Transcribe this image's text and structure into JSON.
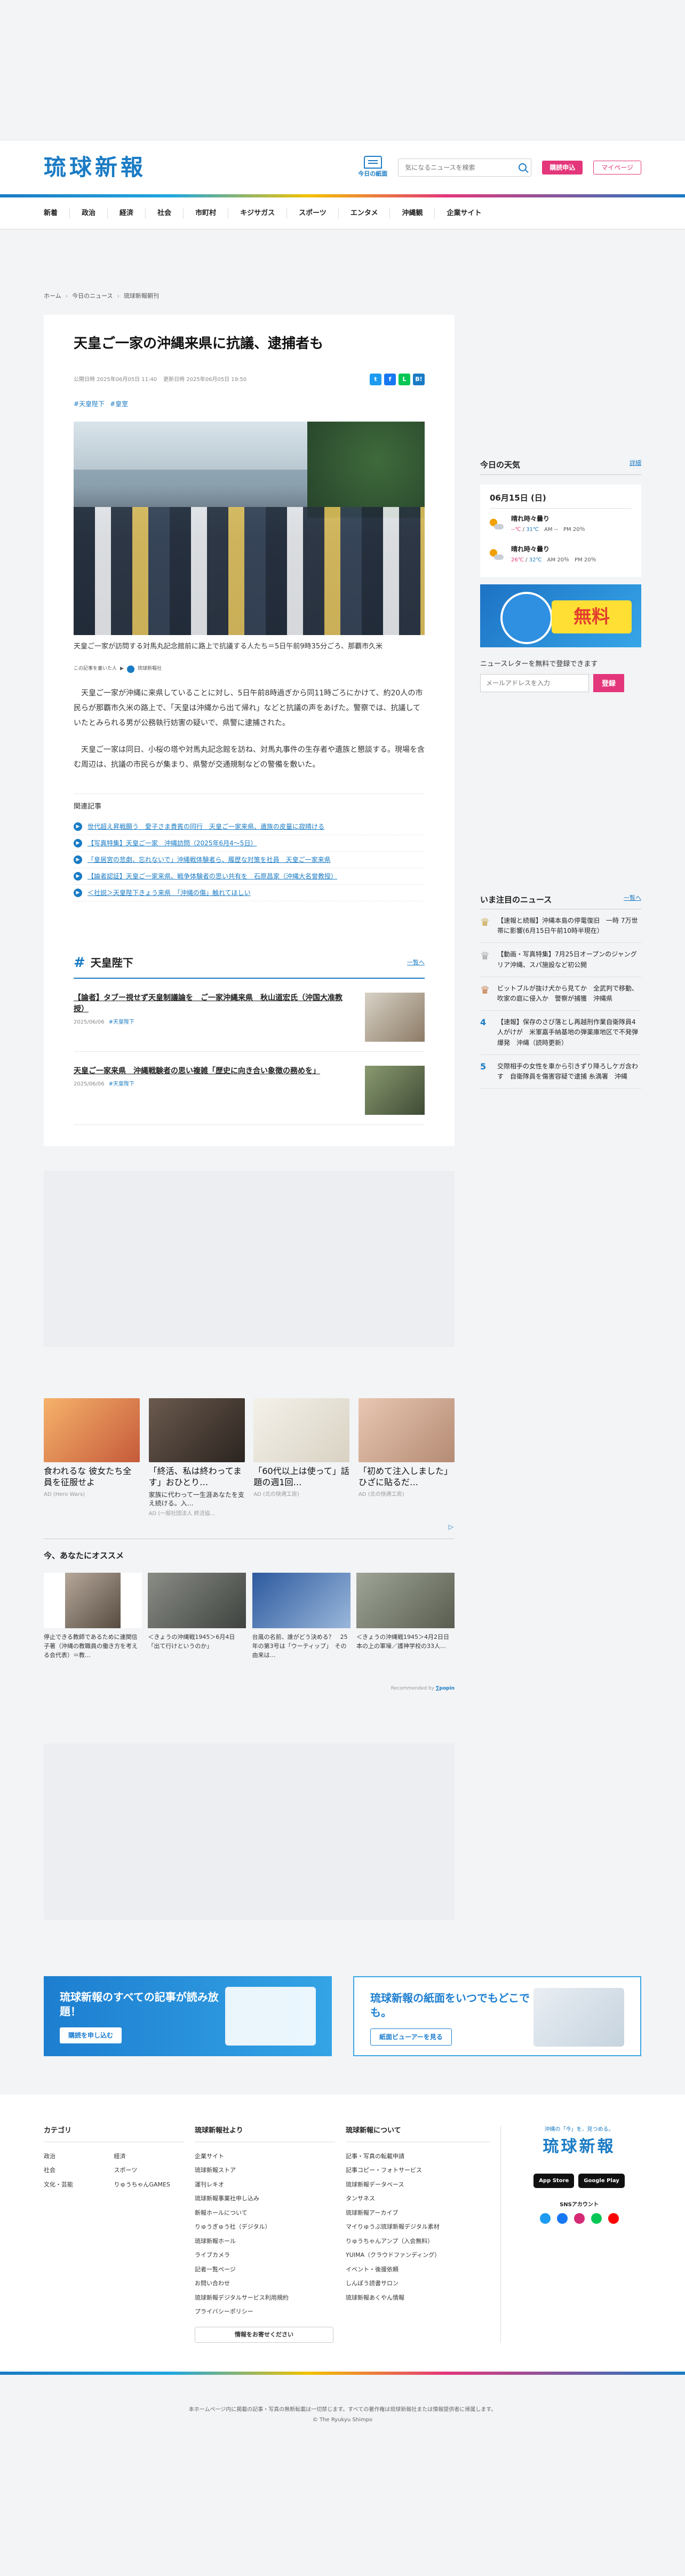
{
  "header": {
    "logo": "琉球新報",
    "today_paper": "今日の紙面",
    "search_placeholder": "気になるニュースを検索",
    "subscribe": "購読申込",
    "mypage": "マイページ"
  },
  "nav": [
    "政治",
    "経済",
    "社会",
    "市町村",
    "キジサガス",
    "スポーツ",
    "エンタメ",
    "沖縄観",
    "企業サイト"
  ],
  "nav_first": "新着",
  "breadcrumb": [
    "ホーム",
    "今日のニュース",
    "琉球新報朝刊"
  ],
  "article": {
    "title": "天皇ご一家の沖縄来県に抗議、逮捕者も",
    "published": "公開日時 2025年06月05日 11:40",
    "updated": "更新日時 2025年06月05日 19:50",
    "tags": [
      "#天皇陛下",
      "#皇室"
    ],
    "caption": "天皇ご一家が訪問する対馬丸記念館前に路上で抗議する人たち＝5日午前9時35分ごろ、那覇市久米",
    "reporter": "この記事を書いた人",
    "reporter_name": "琉球新報社",
    "paragraphs": [
      "天皇ご一家が沖縄に来県していることに対し、5日午前8時過ぎから同11時ごろにかけて、約20人の市民らが那覇市久米の路上で、「天皇は沖縄から出て帰れ」などと抗議の声をあげた。警察では、抗議していたとみられる男が公務執行妨害の疑いで、県警に逮捕された。",
      "天皇ご一家は同日、小桜の塔や対馬丸記念館を訪ね、対馬丸事件の生存者や遺族と懇談する。現場を含む周辺は、抗議の市民らが集まり、県警が交通規制などの警備を敷いた。"
    ],
    "related_title": "関連記事",
    "related": [
      "世代超え昇戦願う　愛子さま貴賓の同行　天皇ご一家来県、遺族の皮量に寂晴ける",
      "【写真特集】天皇ご一家　沖縄訪問（2025年6月4〜5日）",
      "「皇居宮の悲劇、忘れないで」沖縄戦体験者ら、履歴な対策を社員　天皇ご一家来県",
      "【論者認証】天皇ご一家来県、戦争体験者の思い共有を　石原昌家（沖縄大名誉教授）",
      "＜社説＞天皇陛下きょう来県　「沖縄の傷」触れてほしい"
    ]
  },
  "tag_section": {
    "title": "天皇陛下",
    "more": "一覧へ",
    "items": [
      {
        "title": "【論者】タブー視せず天皇制議論を　ご一家沖縄来県　秋山道宏氏（沖国大准教授）",
        "date": "2025/06/06",
        "tag": "#天皇陛下"
      },
      {
        "title": "天皇ご一家来県　沖縄戦験者の思い複雑「歴史に向き合い象徴の務めを」",
        "date": "2025/06/06",
        "tag": "#天皇陛下"
      }
    ]
  },
  "ads": [
    {
      "headline": "食われるな 彼女たち全員を征服せよ",
      "sub": "",
      "source": "AD (Hero Wars)"
    },
    {
      "headline": "「終活、私は終わってます」おひとり…",
      "sub": "家族に代わって一生涯あなたを支え続ける。入…",
      "source": "AD (一般社団法人 終活協…"
    },
    {
      "headline": "「60代以上は使って」話題の週1回…",
      "sub": "",
      "source": "AD (北の快適工房)"
    },
    {
      "headline": "「初めて注入しました」ひざに貼るだ…",
      "sub": "",
      "source": "AD (北の快適工房)"
    }
  ],
  "recommend": {
    "title": "今、あなたにオススメ",
    "items": [
      "停止できる教師であるために連関信子著（沖縄の教職員の働き方を考える会代表）＝教…",
      "＜きょうの沖縄戦1945＞6月4日「出て行けというのか」",
      "台風の名前、誰がどう決める？　25年の第3号は「ウーティップ」　その由来は…",
      "＜きょうの沖縄戦1945＞4月2日日　本の上の軍壕／護神学校の33人…"
    ],
    "powered": "Recommended by"
  },
  "sidebar": {
    "weather_title": "今日の天気",
    "weather_more": "詳細",
    "weather_date": "06月15日 (日)",
    "weather": [
      {
        "label": "晴れ時々曇り",
        "hi": "--℃",
        "lo": "31℃",
        "am": "AM --",
        "pm": "PM 20％"
      },
      {
        "label": "晴れ時々曇り",
        "hi": "26℃",
        "lo": "32℃",
        "am": "AM 20％",
        "pm": "PM 20％"
      }
    ],
    "banner_text": "無料",
    "newsletter_label": "ニュースレターを無料で登録できます",
    "newsletter_placeholder": "メールアドレスを入力",
    "newsletter_button": "登録",
    "rank_title": "いま注目のニュース",
    "rank_more": "一覧へ",
    "ranking": [
      "【速報と続報】沖縄本島の停電復旧　一時 7万世帯に影響(6月15日午前10時半現在）",
      "【動画・写真特集】7月25日オープンのジャングリア沖縄、スパ施設など初公開",
      "ビットブルが抜け犬から見てか　全武判で移動、吹家の庭に侵入か　警察が捕獲　沖縄県",
      "【速報】保存のさび落とし再越刑作業自衛隊員4人がけが　米軍嘉手納基地の弾薬庫地区で不発弾爆発　沖縄（読時更新）",
      "交際相手の女性を車から引きずり降ろしケガ含わす　自衛隊員を傷害容疑で逮捕 糸満署　沖縄"
    ]
  },
  "promo": [
    {
      "headline": "琉球新報のすべての記事が読み放題！",
      "button": "購読を申し込む"
    },
    {
      "headline": "琉球新報の紙面をいつでもどこでも。",
      "button": "紙面ビューアーを見る"
    }
  ],
  "footer": {
    "cat_title": "カテゴリ",
    "categories": [
      "政治",
      "経済",
      "社会",
      "スポーツ",
      "文化・芸能",
      "りゅうちゃんGAMES"
    ],
    "about_title": "琉球新報社より",
    "about": [
      "企業サイト",
      "琉球新報ストア",
      "運刊レキオ",
      "琉球新報事業社申し込み",
      "新報ホールについて",
      "りゅうぎゅう社（デジタル）",
      "琉球新報ホール",
      "ライブカメラ",
      "記者一覧ページ",
      "お問い合わせ",
      "琉球新報デジタルサービス利用規約",
      "プライバシーポリシー"
    ],
    "about_button": "情報をお寄せください",
    "info_title": "琉球新報について",
    "info": [
      "記事・写真の転載申請",
      "記事コピー・フォトサービス",
      "琉球新報データベース",
      "タンサネス",
      "琉球新報アーカイブ",
      "マイりゅうぶ琉球新報デジタル素材",
      "りゅうちゃんアンプ（入会無料）",
      "YUIMA（クラウドファンディング）",
      "イベント・後援依頼",
      "しんぽう読書サロン",
      "琉球新報あくやん情報"
    ],
    "brand_tag": "沖縄の「今」を、見つめる。",
    "brand_logo": "琉球新報",
    "app_store": "App Store",
    "google_play": "Google Play",
    "sns": "SNSアカウント"
  },
  "copyright": [
    "本ホームページ内に掲載の記事・写真の無断転載は一切禁じます。すべての著作権は琉球新報社または情報提供者に帰属します。",
    "© The Ryukyu Shimpo"
  ],
  "colors": {
    "brand_blue": "#1a7bc4",
    "accent_pink": "#e4367b"
  }
}
